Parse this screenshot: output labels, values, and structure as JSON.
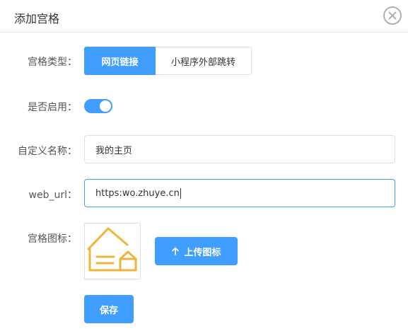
{
  "dialog": {
    "title": "添加宫格",
    "close_icon": "close-circle-icon"
  },
  "form": {
    "type_label": "宫格类型：",
    "type_options": [
      "网页链接",
      "小程序外部跳转"
    ],
    "type_selected": "网页链接",
    "enabled_label": "是否启用：",
    "enabled": true,
    "name_label": "自定义名称：",
    "name_value": "我的主页",
    "url_label": "web_url：",
    "url_value": "https:wo.zhuye.cn",
    "icon_label": "宫格图标：",
    "icon_preview": "house-outline-icon",
    "upload_label": "上传图标",
    "save_label": "保存"
  },
  "colors": {
    "accent": "#409eff",
    "icon_stroke": "#f0b43c",
    "border": "#dcdfe6"
  }
}
